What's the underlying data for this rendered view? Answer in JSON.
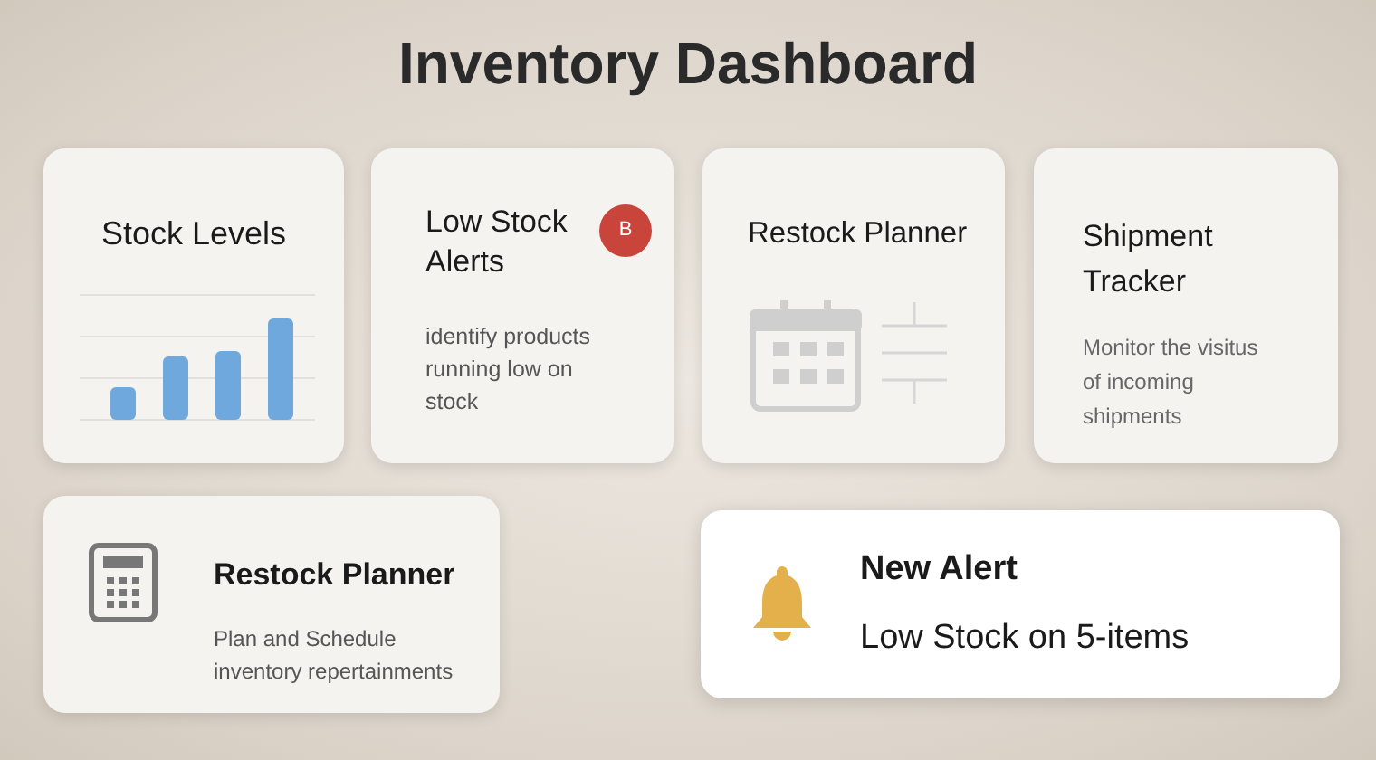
{
  "title": "Inventory Dashboard",
  "cards": [
    {
      "kind": "chart",
      "title": "Stock Levels"
    },
    {
      "kind": "badge",
      "title": "Low Stock Alerts",
      "badge": "B",
      "description": "identify products running low on stock"
    },
    {
      "kind": "calendar",
      "title": "Restock Planner"
    },
    {
      "kind": "text",
      "title": "Shipment Tracker",
      "description": "Monitor the visitus of incoming shipments"
    }
  ],
  "planner": {
    "title": "Restock Planner",
    "description": "Plan and Schedule inventory repertainments"
  },
  "alert": {
    "title": "New Alert",
    "message": "Low Stock on 5-items"
  }
}
